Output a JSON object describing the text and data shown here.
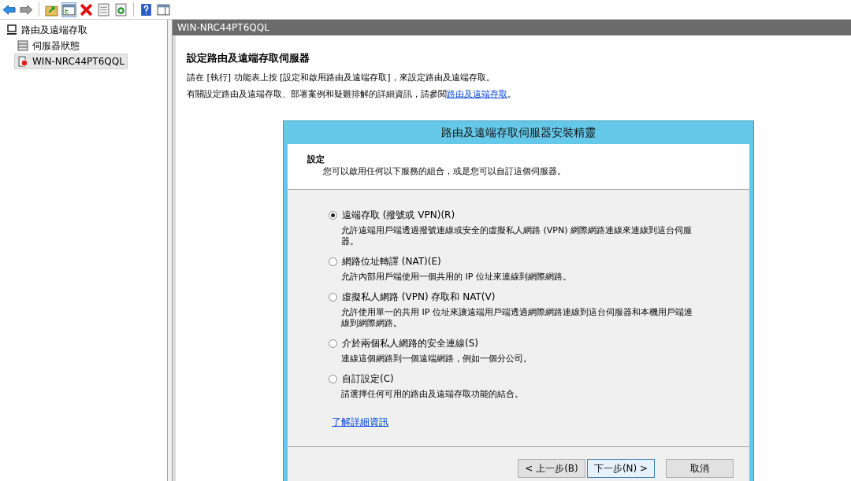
{
  "toolbar": {
    "buttons": [
      {
        "kind": "back"
      },
      {
        "kind": "forward"
      },
      {
        "kind": "up"
      },
      {
        "kind": "tree"
      },
      {
        "kind": "delete"
      },
      {
        "kind": "properties"
      },
      {
        "kind": "refresh"
      },
      {
        "kind": "help"
      },
      {
        "kind": "panel"
      }
    ]
  },
  "tree": {
    "items": [
      {
        "label": "路由及遠端存取",
        "kind": "root",
        "selected": false,
        "children": [
          {
            "label": "伺服器狀態",
            "kind": "status",
            "selected": false
          },
          {
            "label": "WIN-NRC44PT6QQL",
            "kind": "server",
            "selected": true
          }
        ]
      }
    ]
  },
  "pane": {
    "title": "WIN-NRC44PT6QQL",
    "heading": "設定路由及遠端存取伺服器",
    "line_1": "請在 [執行] 功能表上按 [設定和啟用路由及遠端存取]，來設定路由及遠端存取。",
    "line_2": "有關設定路由及遠端存取、部署案例和疑難排解的詳細資訊，請參閱",
    "link": "路由及遠端存取",
    "line_2_end": "。"
  },
  "wizard": {
    "title": "路由及遠端存取伺服器安裝精靈",
    "section": "設定",
    "subtitle": "您可以啟用任何以下服務的組合，或是您可以自訂這個伺服器。",
    "options": [
      {
        "label": "遠端存取 (撥號或 VPN)(R)",
        "description": "允許遠端用戶端透過撥號連線或安全的虛擬私人網路 (VPN) 網際網路連線來連線到這台伺服器。",
        "selected": true
      },
      {
        "label": "網路位址轉譯 (NAT)(E)",
        "description": "允許內部用戶端使用一個共用的 IP 位址來連線到網際網路。",
        "selected": false
      },
      {
        "label": "虛擬私人網路 (VPN) 存取和 NAT(V)",
        "description": "允許使用單一的共用 IP 位址來讓遠端用戶端透過網際網路連線到這台伺服器和本機用戶端連線到網際網路。",
        "selected": false
      },
      {
        "label": "介於兩個私人網路的安全連線(S)",
        "description": "連線這個網路到一個遠端網路，例如一個分公司。",
        "selected": false
      },
      {
        "label": "自訂設定(C)",
        "description": "請選擇任何可用的路由及遠端存取功能的結合。",
        "selected": false
      }
    ],
    "more_link": "了解詳細資訊",
    "buttons": [
      {
        "label": "< 上一步(B)",
        "kind": "normal"
      },
      {
        "label": "下一步(N) >",
        "kind": "default"
      },
      {
        "label": "取消",
        "kind": "cancel"
      }
    ]
  }
}
